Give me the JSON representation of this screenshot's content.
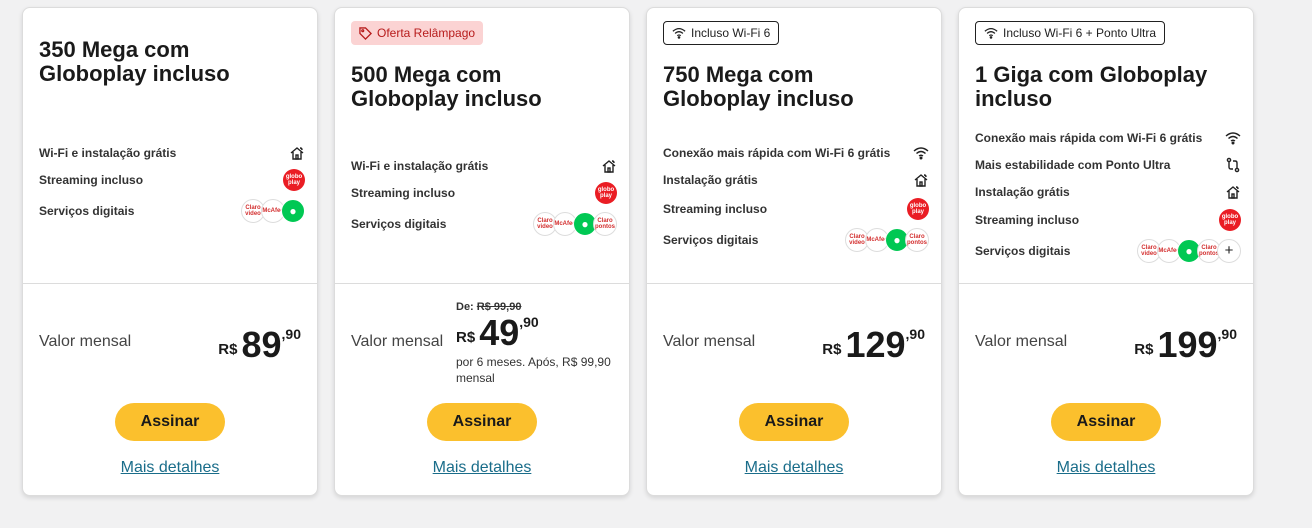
{
  "cards": [
    {
      "title": "350 Mega com Globoplay incluso",
      "badge": "",
      "features": [
        {
          "label": "Wi-Fi e instalação grátis",
          "icon": "home-wifi-icon"
        },
        {
          "label": "Streaming incluso",
          "icon": "globoplay-icon"
        },
        {
          "label": "Serviços digitais",
          "icon": "services-icons"
        }
      ],
      "monthly_label": "Valor mensal",
      "currency": "R$",
      "price_int": "89",
      "price_cents": ",90",
      "cta": "Assinar",
      "details": "Mais detalhes"
    },
    {
      "title": "500 Mega com Globoplay incluso",
      "badge": "Oferta Relâmpago",
      "features": [
        {
          "label": "Wi-Fi e instalação grátis",
          "icon": "home-wifi-icon"
        },
        {
          "label": "Streaming incluso",
          "icon": "globoplay-icon"
        },
        {
          "label": "Serviços digitais",
          "icon": "services-icons"
        }
      ],
      "monthly_label": "Valor mensal",
      "old_prefix": "De:",
      "old_price": "R$ 99,90",
      "currency": "R$",
      "price_int": "49",
      "price_cents": ",90",
      "price_note": "por 6 meses. Após, R$ 99,90 mensal",
      "cta": "Assinar",
      "details": "Mais detalhes"
    },
    {
      "title": "750 Mega com Globoplay incluso",
      "badge": "Incluso Wi-Fi 6",
      "features": [
        {
          "label": "Conexão mais rápida com Wi-Fi 6 grátis",
          "icon": "wifi-icon"
        },
        {
          "label": "Instalação grátis",
          "icon": "home-wifi-icon"
        },
        {
          "label": "Streaming incluso",
          "icon": "globoplay-icon"
        },
        {
          "label": "Serviços digitais",
          "icon": "services-icons"
        }
      ],
      "monthly_label": "Valor mensal",
      "currency": "R$",
      "price_int": "129",
      "price_cents": ",90",
      "cta": "Assinar",
      "details": "Mais detalhes"
    },
    {
      "title": "1 Giga com Globoplay incluso",
      "badge": "Incluso Wi-Fi 6 + Ponto Ultra",
      "features": [
        {
          "label": "Conexão mais rápida com Wi-Fi 6 grátis",
          "icon": "wifi-icon"
        },
        {
          "label": "Mais estabilidade com Ponto Ultra",
          "icon": "route-icon"
        },
        {
          "label": "Instalação grátis",
          "icon": "home-wifi-icon"
        },
        {
          "label": "Streaming incluso",
          "icon": "globoplay-icon"
        },
        {
          "label": "Serviços digitais",
          "icon": "services-icons"
        }
      ],
      "monthly_label": "Valor mensal",
      "currency": "R$",
      "price_int": "199",
      "price_cents": ",90",
      "cta": "Assinar",
      "details": "Mais detalhes"
    }
  ],
  "icon_text": {
    "globoplay": "globo play",
    "claro_video": "Claro video",
    "mcafee": "McAfee",
    "claro_pontos": "Claro pontos"
  },
  "colors": {
    "cta": "#fbc02d",
    "link": "#1a6d8a",
    "promo_bg": "#fbd3d3",
    "promo_text": "#b71c1c",
    "globoplay": "#ea1d24",
    "green_service": "#00c853"
  }
}
